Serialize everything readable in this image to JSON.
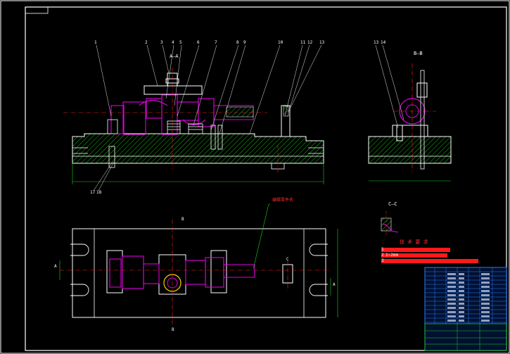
{
  "colors": {
    "background": "#000000",
    "outline": "#ffffff",
    "hatch": "#14c214",
    "part": "#e000e0",
    "centerline": "#ff2020",
    "dimension": "#18d618",
    "note": "#ff2020",
    "leader": "#e8e8e8",
    "titleblock": "#2a7cff"
  },
  "views": {
    "section_aa": {
      "title": "A—A"
    },
    "section_bb": {
      "title": "B—B"
    },
    "section_cc": {
      "title": "C—C"
    },
    "plan": {
      "cut_a": "A",
      "cut_b": "B",
      "cut_c": "C",
      "note": "编辑零件名"
    }
  },
  "balloons_aa": [
    "1",
    "2",
    "3",
    "4",
    "5",
    "6",
    "7",
    "8",
    "9",
    "10",
    "11",
    "12",
    "13"
  ],
  "balloons_bb": [
    "13",
    "14"
  ],
  "balloons_bottom": [
    "17",
    "18"
  ],
  "tech_req": {
    "title": "技 术 要 求",
    "items": [
      {
        "num": "1",
        "text": ""
      },
      {
        "num": "2",
        "text": "1~2mm"
      },
      {
        "num": "3",
        "text": ""
      }
    ]
  }
}
